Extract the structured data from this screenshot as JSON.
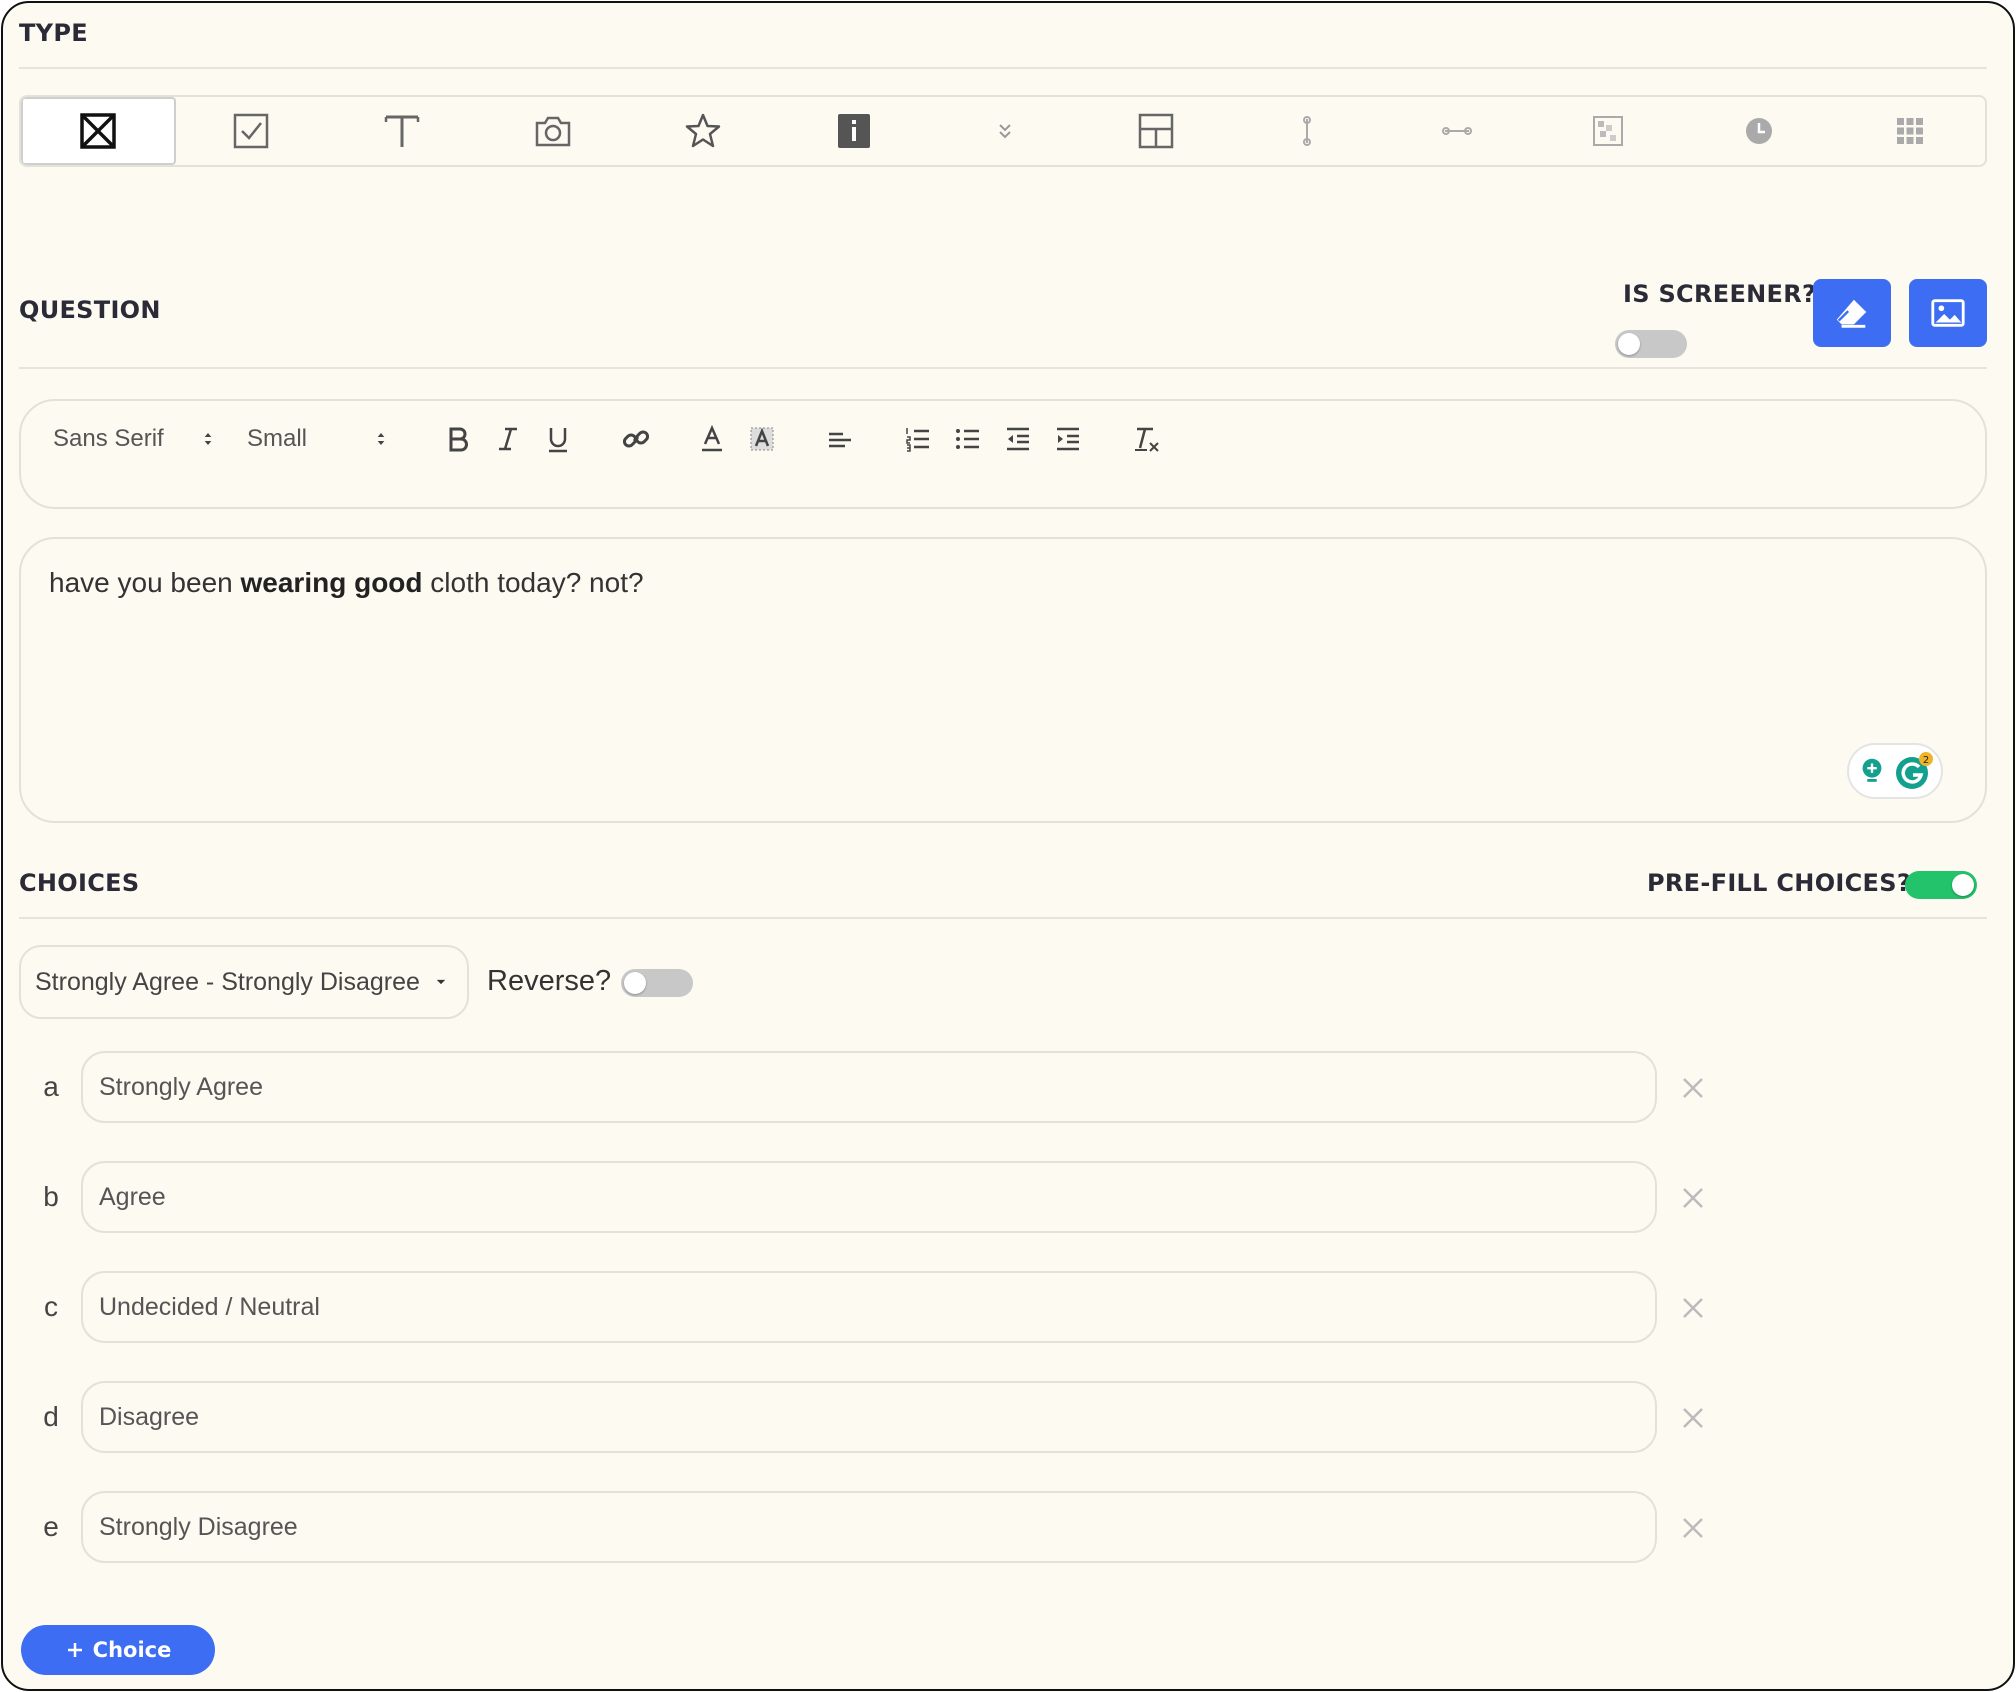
{
  "sections": {
    "type_label": "TYPE",
    "question_label": "QUESTION",
    "choices_label": "CHOICES"
  },
  "question_types": [
    {
      "icon": "cross-box-icon",
      "active": true
    },
    {
      "icon": "checkbox-icon",
      "active": false
    },
    {
      "icon": "text-icon",
      "active": false
    },
    {
      "icon": "camera-icon",
      "active": false
    },
    {
      "icon": "star-icon",
      "active": false
    },
    {
      "icon": "info-icon",
      "active": false
    },
    {
      "icon": "chevron-double-down-icon",
      "active": false
    },
    {
      "icon": "layout-icon",
      "active": false
    },
    {
      "icon": "vertical-slider-icon",
      "active": false
    },
    {
      "icon": "horizontal-slider-icon",
      "active": false
    },
    {
      "icon": "grid-image-icon",
      "active": false
    },
    {
      "icon": "clock-icon",
      "active": false
    },
    {
      "icon": "apps-grid-icon",
      "active": false
    }
  ],
  "screener": {
    "label": "IS SCREENER?",
    "enabled": false
  },
  "editor": {
    "font_family": "Sans Serif",
    "font_size": "Small",
    "text_before": "have you been ",
    "text_bold": "wearing good",
    "text_after": " cloth today? not?",
    "grammarly_count": "2"
  },
  "prefill": {
    "label": "PRE-FILL CHOICES?",
    "enabled": true
  },
  "scale": {
    "selected": "Strongly Agree - Strongly Disagree"
  },
  "reverse": {
    "label": "Reverse?",
    "enabled": false
  },
  "choices": [
    {
      "letter": "a",
      "value": "Strongly Agree"
    },
    {
      "letter": "b",
      "value": "Agree"
    },
    {
      "letter": "c",
      "value": "Undecided / Neutral"
    },
    {
      "letter": "d",
      "value": "Disagree"
    },
    {
      "letter": "e",
      "value": "Strongly Disagree"
    }
  ],
  "add_choice_label": "Choice",
  "colors": {
    "accent": "#3d6df2",
    "toggle_on": "#22c36b",
    "background": "#fdfaf2"
  }
}
